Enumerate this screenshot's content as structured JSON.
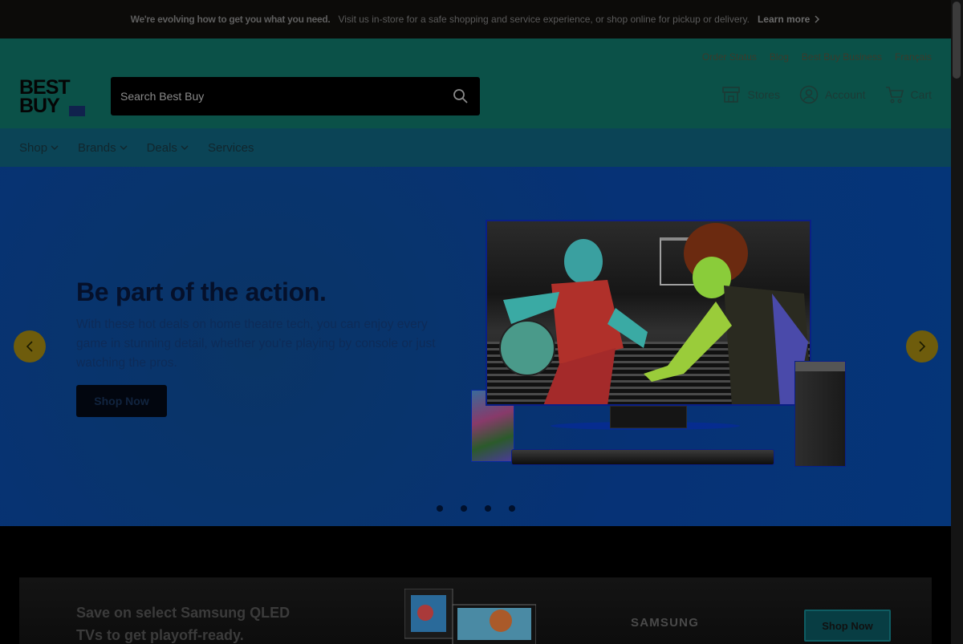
{
  "announcement": {
    "bold": "We're evolving how to get you what you need.",
    "text": "Visit us in-store for a safe shopping and service experience, or shop online for pickup or delivery.",
    "link": "Learn more"
  },
  "header": {
    "utility_links": [
      "Order Status",
      "Blog",
      "Best Buy Business",
      "Français"
    ],
    "logo": {
      "line1": "BEST",
      "line2": "BUY"
    },
    "search": {
      "placeholder": "Search Best Buy",
      "value": ""
    },
    "actions": {
      "stores": "Stores",
      "account": "Account",
      "cart": "Cart"
    },
    "colors": {
      "header_bg": "#0b5148",
      "nav_bg": "#0b4456",
      "search_bg": "#000000"
    }
  },
  "nav": {
    "items": [
      {
        "label": "Shop",
        "has_dropdown": true
      },
      {
        "label": "Brands",
        "has_dropdown": true
      },
      {
        "label": "Deals",
        "has_dropdown": true
      },
      {
        "label": "Services",
        "has_dropdown": false
      }
    ]
  },
  "hero": {
    "title": "Be part of the action.",
    "text": "With these hot deals on home theatre tech, you can enjoy every game in stunning detail, whether you're playing by console or just watching the pros.",
    "button": "Shop Now",
    "slides": 4,
    "active_slide": 1,
    "icons": {
      "prev": "chevron-left-icon",
      "next": "chevron-right-icon"
    }
  },
  "promo": {
    "text": "Save on select Samsung QLED TVs to get playoff-ready.",
    "brand": "SAMSUNG",
    "button": "Shop Now"
  }
}
